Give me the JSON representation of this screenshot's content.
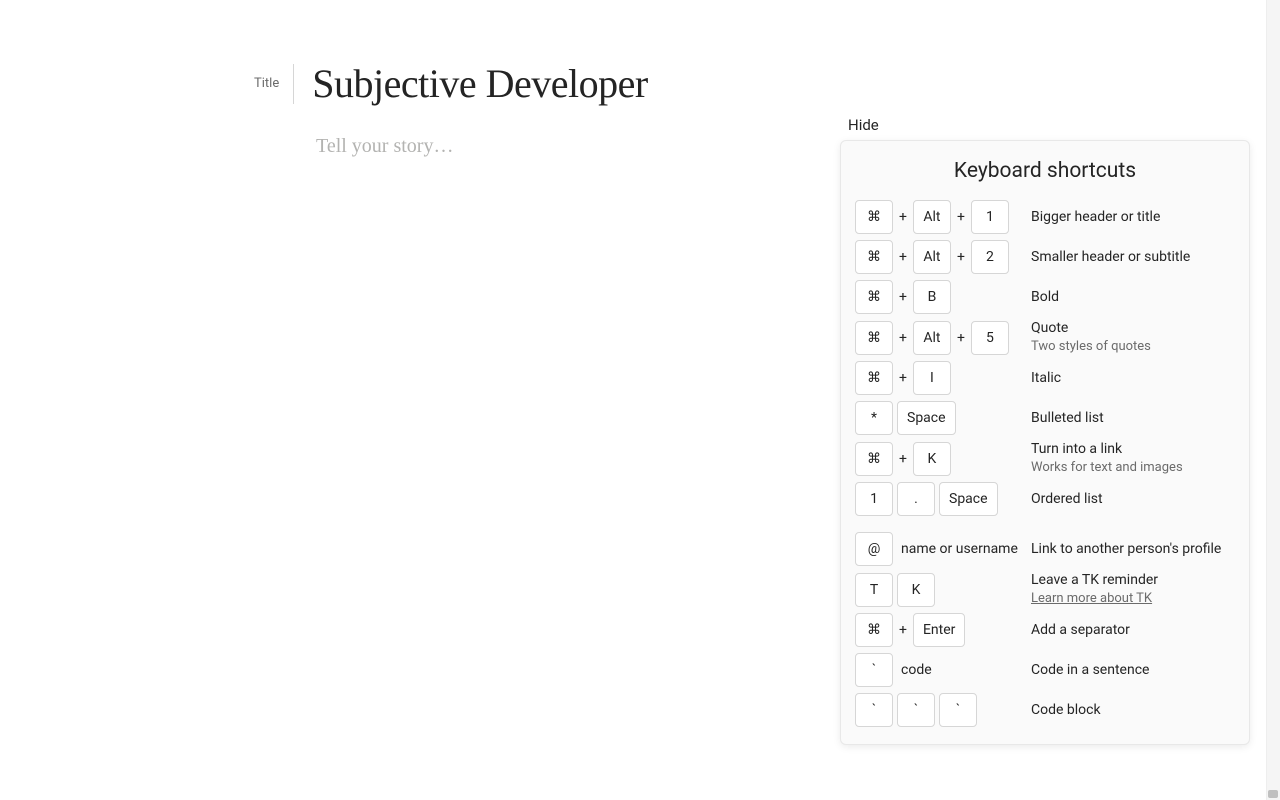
{
  "editor": {
    "title_label": "Title",
    "title_text": "Subjective Developer",
    "story_placeholder": "Tell your story…"
  },
  "hide_label": "Hide",
  "shortcuts": {
    "title": "Keyboard shortcuts",
    "cmd_glyph": "⌘",
    "rows": [
      {
        "keys": [
          {
            "t": "k",
            "v": "⌘"
          },
          {
            "t": "p"
          },
          {
            "t": "k",
            "v": "Alt"
          },
          {
            "t": "p"
          },
          {
            "t": "k",
            "v": "1"
          }
        ],
        "desc": "Bigger header or title"
      },
      {
        "keys": [
          {
            "t": "k",
            "v": "⌘"
          },
          {
            "t": "p"
          },
          {
            "t": "k",
            "v": "Alt"
          },
          {
            "t": "p"
          },
          {
            "t": "k",
            "v": "2"
          }
        ],
        "desc": "Smaller header or subtitle"
      },
      {
        "keys": [
          {
            "t": "k",
            "v": "⌘"
          },
          {
            "t": "p"
          },
          {
            "t": "k",
            "v": "B"
          }
        ],
        "desc": "Bold"
      },
      {
        "keys": [
          {
            "t": "k",
            "v": "⌘"
          },
          {
            "t": "p"
          },
          {
            "t": "k",
            "v": "Alt"
          },
          {
            "t": "p"
          },
          {
            "t": "k",
            "v": "5"
          }
        ],
        "desc": "Quote",
        "sub": "Two styles of quotes"
      },
      {
        "keys": [
          {
            "t": "k",
            "v": "⌘"
          },
          {
            "t": "p"
          },
          {
            "t": "k",
            "v": "I"
          }
        ],
        "desc": "Italic"
      },
      {
        "keys": [
          {
            "t": "k",
            "v": "*"
          },
          {
            "t": "k",
            "v": "Space"
          }
        ],
        "desc": "Bulleted list"
      },
      {
        "keys": [
          {
            "t": "k",
            "v": "⌘"
          },
          {
            "t": "p"
          },
          {
            "t": "k",
            "v": "K"
          }
        ],
        "desc": "Turn into a link",
        "sub": "Works for text and images"
      },
      {
        "keys": [
          {
            "t": "k",
            "v": "1"
          },
          {
            "t": "k",
            "v": "."
          },
          {
            "t": "k",
            "v": "Space"
          }
        ],
        "desc": "Ordered list"
      },
      {
        "gap": true
      },
      {
        "keys": [
          {
            "t": "k",
            "v": "@"
          },
          {
            "t": "txt",
            "v": "name or username"
          }
        ],
        "desc": "Link to another person's profile"
      },
      {
        "keys": [
          {
            "t": "k",
            "v": "T"
          },
          {
            "t": "k",
            "v": "K"
          }
        ],
        "desc": "Leave a TK reminder",
        "link": "Learn more about TK"
      },
      {
        "keys": [
          {
            "t": "k",
            "v": "⌘"
          },
          {
            "t": "p"
          },
          {
            "t": "k",
            "v": "Enter"
          }
        ],
        "desc": "Add a separator"
      },
      {
        "keys": [
          {
            "t": "k",
            "v": "`"
          },
          {
            "t": "txt",
            "v": "code"
          }
        ],
        "desc": "Code in a sentence"
      },
      {
        "keys": [
          {
            "t": "k",
            "v": "`"
          },
          {
            "t": "k",
            "v": "`"
          },
          {
            "t": "k",
            "v": "`"
          }
        ],
        "desc": "Code block"
      }
    ]
  }
}
